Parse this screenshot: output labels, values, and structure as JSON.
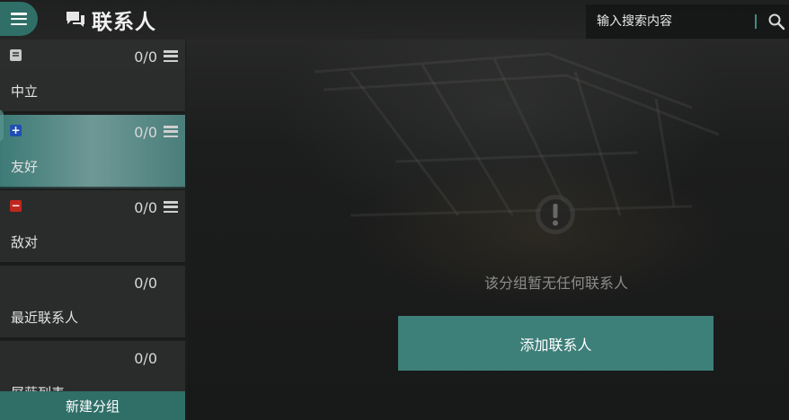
{
  "header": {
    "title": "联系人",
    "menu_icon": "hamburger-menu-icon",
    "title_icon": "chat-bubbles-icon"
  },
  "search": {
    "placeholder": "输入搜索内容",
    "value": "",
    "icon": "search-icon"
  },
  "sidebar": {
    "groups": [
      {
        "name": "中立",
        "count": "0/0",
        "badge": "neutral",
        "badge_symbol": "=",
        "active": false,
        "has_handle": true
      },
      {
        "name": "友好",
        "count": "0/0",
        "badge": "friend",
        "badge_symbol": "+",
        "active": true,
        "has_handle": true
      },
      {
        "name": "敌对",
        "count": "0/0",
        "badge": "enemy",
        "badge_symbol": "−",
        "active": false,
        "has_handle": true
      },
      {
        "name": "最近联系人",
        "count": "0/0",
        "badge": "",
        "badge_symbol": "",
        "active": false,
        "has_handle": false
      },
      {
        "name": "屏蔽列表",
        "count": "0/0",
        "badge": "",
        "badge_symbol": "",
        "active": false,
        "has_handle": false
      }
    ],
    "new_group_label": "新建分组"
  },
  "main": {
    "empty_message": "该分组暂无任何联系人",
    "empty_icon": "exclamation-circle-icon",
    "add_contact_label": "添加联系人"
  },
  "colors": {
    "accent": "#2f6f68",
    "active_group": "#6e9896",
    "friend_badge": "#1f4fb4",
    "enemy_badge": "#c0261f",
    "neutral_badge": "#c9c9c9"
  }
}
